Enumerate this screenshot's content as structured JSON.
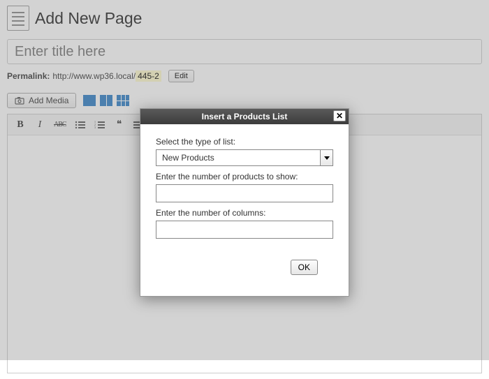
{
  "header": {
    "title": "Add New Page"
  },
  "title_input": {
    "placeholder": "Enter title here",
    "value": ""
  },
  "permalink": {
    "label": "Permalink:",
    "base": "http://www.wp36.local/",
    "slug": "445-2",
    "edit_label": "Edit"
  },
  "media_row": {
    "add_media_label": "Add Media"
  },
  "toolbar": {
    "bold": "B",
    "italic": "I",
    "strike": "ABC",
    "quote": "❝"
  },
  "dialog": {
    "title": "Insert a Products List",
    "labels": {
      "type": "Select the type of list:",
      "count": "Enter the number of products to show:",
      "columns": "Enter the number of columns:"
    },
    "select": {
      "value": "New Products"
    },
    "inputs": {
      "count_value": "",
      "columns_value": ""
    },
    "ok_label": "OK"
  }
}
